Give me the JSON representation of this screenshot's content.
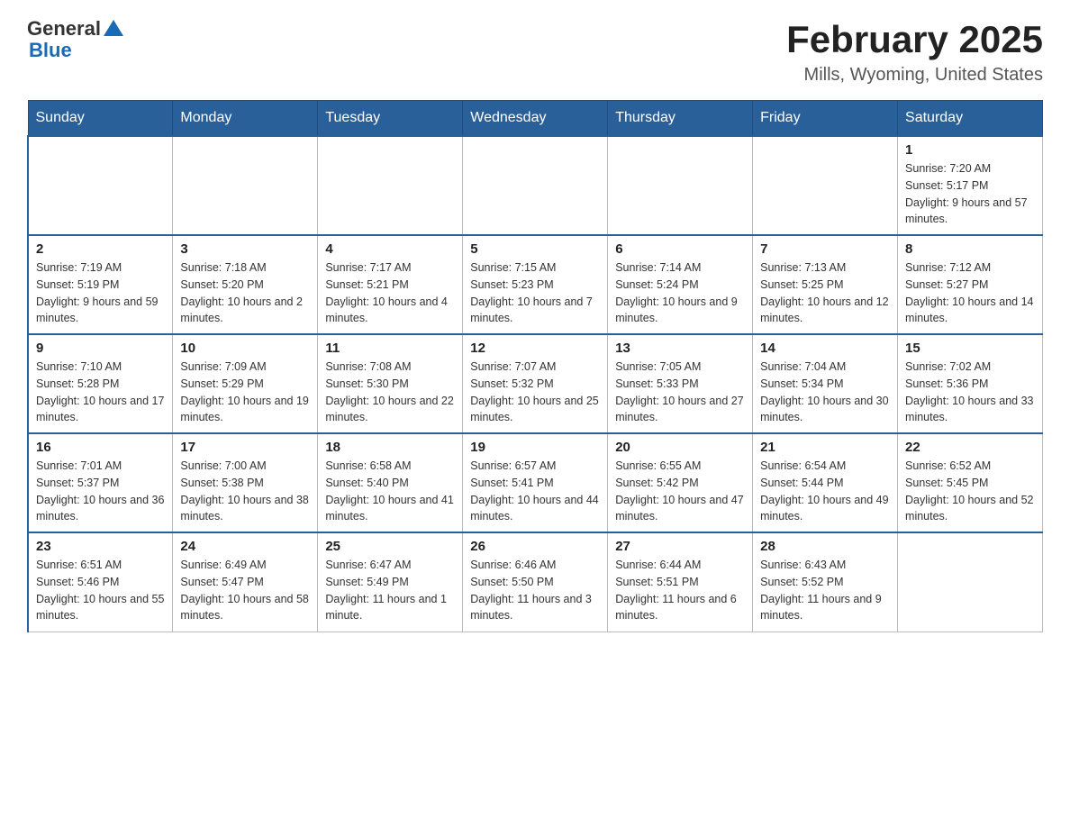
{
  "header": {
    "logo_general": "General",
    "logo_blue": "Blue",
    "month_title": "February 2025",
    "location": "Mills, Wyoming, United States"
  },
  "days_of_week": [
    "Sunday",
    "Monday",
    "Tuesday",
    "Wednesday",
    "Thursday",
    "Friday",
    "Saturday"
  ],
  "weeks": [
    [
      {
        "day": "",
        "info": ""
      },
      {
        "day": "",
        "info": ""
      },
      {
        "day": "",
        "info": ""
      },
      {
        "day": "",
        "info": ""
      },
      {
        "day": "",
        "info": ""
      },
      {
        "day": "",
        "info": ""
      },
      {
        "day": "1",
        "info": "Sunrise: 7:20 AM\nSunset: 5:17 PM\nDaylight: 9 hours and 57 minutes."
      }
    ],
    [
      {
        "day": "2",
        "info": "Sunrise: 7:19 AM\nSunset: 5:19 PM\nDaylight: 9 hours and 59 minutes."
      },
      {
        "day": "3",
        "info": "Sunrise: 7:18 AM\nSunset: 5:20 PM\nDaylight: 10 hours and 2 minutes."
      },
      {
        "day": "4",
        "info": "Sunrise: 7:17 AM\nSunset: 5:21 PM\nDaylight: 10 hours and 4 minutes."
      },
      {
        "day": "5",
        "info": "Sunrise: 7:15 AM\nSunset: 5:23 PM\nDaylight: 10 hours and 7 minutes."
      },
      {
        "day": "6",
        "info": "Sunrise: 7:14 AM\nSunset: 5:24 PM\nDaylight: 10 hours and 9 minutes."
      },
      {
        "day": "7",
        "info": "Sunrise: 7:13 AM\nSunset: 5:25 PM\nDaylight: 10 hours and 12 minutes."
      },
      {
        "day": "8",
        "info": "Sunrise: 7:12 AM\nSunset: 5:27 PM\nDaylight: 10 hours and 14 minutes."
      }
    ],
    [
      {
        "day": "9",
        "info": "Sunrise: 7:10 AM\nSunset: 5:28 PM\nDaylight: 10 hours and 17 minutes."
      },
      {
        "day": "10",
        "info": "Sunrise: 7:09 AM\nSunset: 5:29 PM\nDaylight: 10 hours and 19 minutes."
      },
      {
        "day": "11",
        "info": "Sunrise: 7:08 AM\nSunset: 5:30 PM\nDaylight: 10 hours and 22 minutes."
      },
      {
        "day": "12",
        "info": "Sunrise: 7:07 AM\nSunset: 5:32 PM\nDaylight: 10 hours and 25 minutes."
      },
      {
        "day": "13",
        "info": "Sunrise: 7:05 AM\nSunset: 5:33 PM\nDaylight: 10 hours and 27 minutes."
      },
      {
        "day": "14",
        "info": "Sunrise: 7:04 AM\nSunset: 5:34 PM\nDaylight: 10 hours and 30 minutes."
      },
      {
        "day": "15",
        "info": "Sunrise: 7:02 AM\nSunset: 5:36 PM\nDaylight: 10 hours and 33 minutes."
      }
    ],
    [
      {
        "day": "16",
        "info": "Sunrise: 7:01 AM\nSunset: 5:37 PM\nDaylight: 10 hours and 36 minutes."
      },
      {
        "day": "17",
        "info": "Sunrise: 7:00 AM\nSunset: 5:38 PM\nDaylight: 10 hours and 38 minutes."
      },
      {
        "day": "18",
        "info": "Sunrise: 6:58 AM\nSunset: 5:40 PM\nDaylight: 10 hours and 41 minutes."
      },
      {
        "day": "19",
        "info": "Sunrise: 6:57 AM\nSunset: 5:41 PM\nDaylight: 10 hours and 44 minutes."
      },
      {
        "day": "20",
        "info": "Sunrise: 6:55 AM\nSunset: 5:42 PM\nDaylight: 10 hours and 47 minutes."
      },
      {
        "day": "21",
        "info": "Sunrise: 6:54 AM\nSunset: 5:44 PM\nDaylight: 10 hours and 49 minutes."
      },
      {
        "day": "22",
        "info": "Sunrise: 6:52 AM\nSunset: 5:45 PM\nDaylight: 10 hours and 52 minutes."
      }
    ],
    [
      {
        "day": "23",
        "info": "Sunrise: 6:51 AM\nSunset: 5:46 PM\nDaylight: 10 hours and 55 minutes."
      },
      {
        "day": "24",
        "info": "Sunrise: 6:49 AM\nSunset: 5:47 PM\nDaylight: 10 hours and 58 minutes."
      },
      {
        "day": "25",
        "info": "Sunrise: 6:47 AM\nSunset: 5:49 PM\nDaylight: 11 hours and 1 minute."
      },
      {
        "day": "26",
        "info": "Sunrise: 6:46 AM\nSunset: 5:50 PM\nDaylight: 11 hours and 3 minutes."
      },
      {
        "day": "27",
        "info": "Sunrise: 6:44 AM\nSunset: 5:51 PM\nDaylight: 11 hours and 6 minutes."
      },
      {
        "day": "28",
        "info": "Sunrise: 6:43 AM\nSunset: 5:52 PM\nDaylight: 11 hours and 9 minutes."
      },
      {
        "day": "",
        "info": ""
      }
    ]
  ]
}
